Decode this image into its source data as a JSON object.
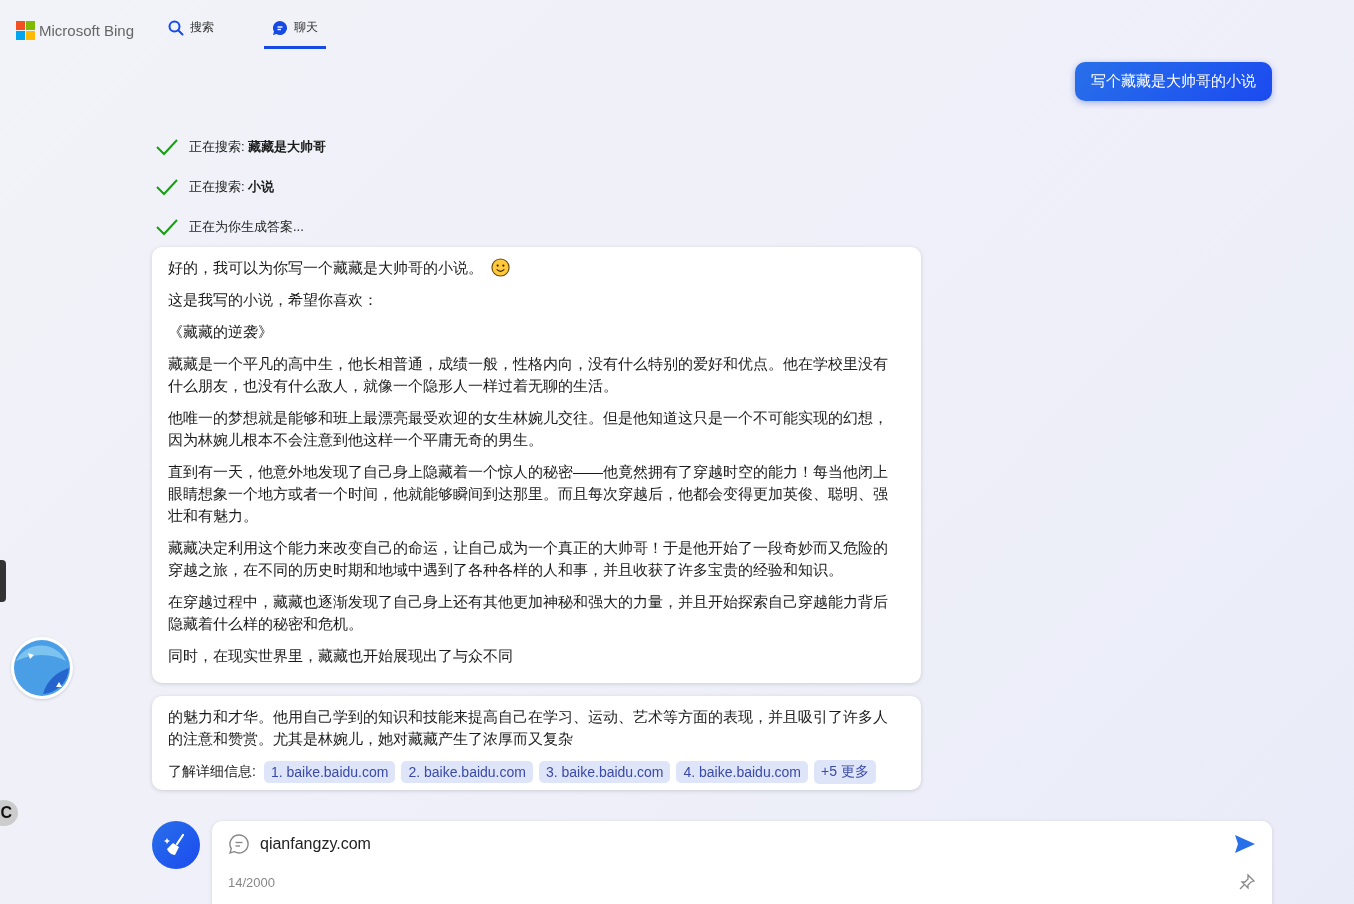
{
  "header": {
    "logo": "Microsoft Bing",
    "tabs": [
      {
        "label": "搜索",
        "kind": "search",
        "selected": false
      },
      {
        "label": "聊天",
        "kind": "chat",
        "selected": true
      }
    ]
  },
  "user_message": "写个藏藏是大帅哥的小说",
  "progress": [
    {
      "text": "正在搜索: **藏藏是大帅哥**",
      "done": true
    },
    {
      "text": "正在搜索: **小说**",
      "done": true
    },
    {
      "text": "正在为你生成答案...",
      "done": true
    }
  ],
  "response_cards": [
    {
      "paragraphs": [
        "好的，我可以为你写一个藏藏是大帅哥的小说。",
        "这是我写的小说，希望你喜欢：",
        "《藏藏的逆袭》",
        "藏藏是一个平凡的高中生，他长相普通，成绩一般，性格内向，没有什么特别的爱好和优点。他在学校里没有什么朋友，也没有什么敌人，就像一个隐形人一样过着无聊的生活。",
        "他唯一的梦想就是能够和班上最漂亮最受欢迎的女生林婉儿交往。但是他知道这只是一个不可能实现的幻想，因为林婉儿根本不会注意到他这样一个平庸无奇的男生。",
        "直到有一天，他意外地发现了自己身上隐藏着一个惊人的秘密——他竟然拥有了穿越时空的能力！每当他闭上眼睛想象一个地方或者一个时间，他就能够瞬间到达那里。而且每次穿越后，他都会变得更加英俊、聪明、强壮和有魅力。",
        "藏藏决定利用这个能力来改变自己的命运，让自己成为一个真正的大帅哥！于是他开始了一段奇妙而又危险的穿越之旅，在不同的历史时期和地域中遇到了各种各样的人和事，并且收获了许多宝贵的经验和知识。",
        "在穿越过程中，藏藏也逐渐发现了自己身上还有其他更加神秘和强大的力量，并且开始探索自己穿越能力背后隐藏着什么样的秘密和危机。",
        "同时，在现实世界里，藏藏也开始展现出了与众不同"
      ],
      "emoji_after_first": true
    },
    {
      "paragraphs": [
        "的魅力和才华。他用自己学到的知识和技能来提高自己在学习、运动、艺术等方面的表现，并且吸引了许多人的注意和赞赏。尤其是林婉儿，她对藏藏产生了浓厚而又复杂"
      ],
      "emoji_after_first": false,
      "sources_label": "了解详细信息:",
      "sources": [
        "1. baike.baidu.com",
        "2. baike.baidu.com",
        "3. baike.baidu.com",
        "4. baike.baidu.com"
      ],
      "more": "+5 更多"
    }
  ],
  "composer": {
    "value": "qianfangzy.com",
    "counter": "14/2000"
  },
  "side_button": "C"
}
